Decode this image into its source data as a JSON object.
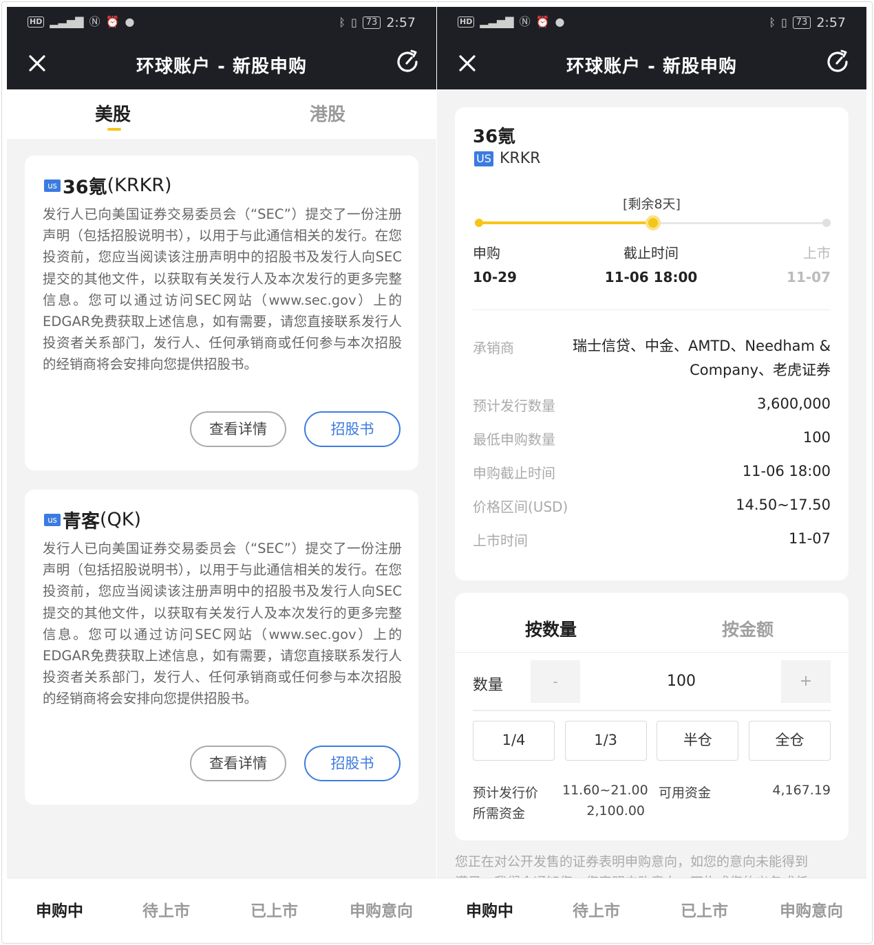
{
  "status_bar": {
    "left_icons": [
      "hd-badge",
      "4g-signal-icon",
      "nfc-icon",
      "alarm-icon",
      "message-icon"
    ],
    "hd": "HD",
    "battery": "73",
    "time": "2:57"
  },
  "navbar": {
    "title": "环球账户 - 新股申购"
  },
  "left": {
    "market_tabs": [
      "美股",
      "港股"
    ],
    "active_market": "美股",
    "cards": [
      {
        "badge": "us",
        "name": "36氪",
        "code": "(KRKR)",
        "desc": "发行人已向美国证券交易委员会（“SEC”）提交了一份注册声明（包括招股说明书），以用于与此通信相关的发行。在您投资前，您应当阅读该注册声明中的招股书及发行人向SEC提交的其他文件，以获取有关发行人及本次发行的更多完整信息。您可以通过访问SEC网站（www.sec.gov）上的EDGAR免费获取上述信息，如有需要，请您直接联系发行人投资者关系部门，发行人、任何承销商或任何参与本次招股的经销商将会安排向您提供招股书。",
        "detail_btn": "查看详情",
        "prospectus_btn": "招股书"
      },
      {
        "badge": "us",
        "name": "青客",
        "code": "(QK)",
        "desc": "发行人已向美国证券交易委员会（“SEC”）提交了一份注册声明（包括招股说明书），以用于与此通信相关的发行。在您投资前，您应当阅读该注册声明中的招股书及发行人向SEC提交的其他文件，以获取有关发行人及本次发行的更多完整信息。您可以通过访问SEC网站（www.sec.gov）上的EDGAR免费获取上述信息，如有需要，请您直接联系发行人投资者关系部门，发行人、任何承销商或任何参与本次招股的经销商将会安排向您提供招股书。",
        "detail_btn": "查看详情",
        "prospectus_btn": "招股书"
      }
    ]
  },
  "right": {
    "stock": {
      "name": "36氪",
      "badge": "US",
      "code": "KRKR"
    },
    "timeline": {
      "remaining": "[剩余8天]",
      "progress": 0.5,
      "milestones": [
        {
          "label": "申购",
          "date": "10-29"
        },
        {
          "label": "截止时间",
          "date": "11-06 18:00"
        },
        {
          "label": "上市",
          "date": "11-07"
        }
      ]
    },
    "details": [
      {
        "label": "承销商",
        "value_line1": "瑞士信贷、中金、AMTD、Needham &",
        "value_line2": "Company、老虎证券"
      },
      {
        "label": "预计发行数量",
        "value": "3,600,000"
      },
      {
        "label": "最低申购数量",
        "value": "100"
      },
      {
        "label": "申购截止时间",
        "value": "11-06 18:00"
      },
      {
        "label": "价格区间(USD)",
        "value": "14.50~17.50"
      },
      {
        "label": "上市时间",
        "value": "11-07"
      }
    ],
    "subscribe": {
      "tabs": [
        "按数量",
        "按金额"
      ],
      "qty_label": "数量",
      "minus": "-",
      "plus": "+",
      "qty_value": "100",
      "fractions": [
        "1/4",
        "1/3",
        "半仓",
        "全仓"
      ],
      "est_price_label": "预计发行价",
      "est_price": "11.60~21.00",
      "available_label": "可用资金",
      "available": "4,167.19",
      "required_label": "所需资金",
      "required": "2,100.00"
    },
    "disclaimer_line1": "您正在对公开发售的证券表明申购意向，如您的意向未能得到",
    "disclaimer_line2": "满足，我们会通知您，您表明申购意向，不构成您的义务或任"
  },
  "tabbar": {
    "items": [
      "申购中",
      "待上市",
      "已上市",
      "申购意向"
    ],
    "active": "申购中"
  },
  "colors": {
    "accent_yellow": "#f5c518",
    "link_blue": "#3c7be0",
    "header_dark": "#1e1f24"
  }
}
